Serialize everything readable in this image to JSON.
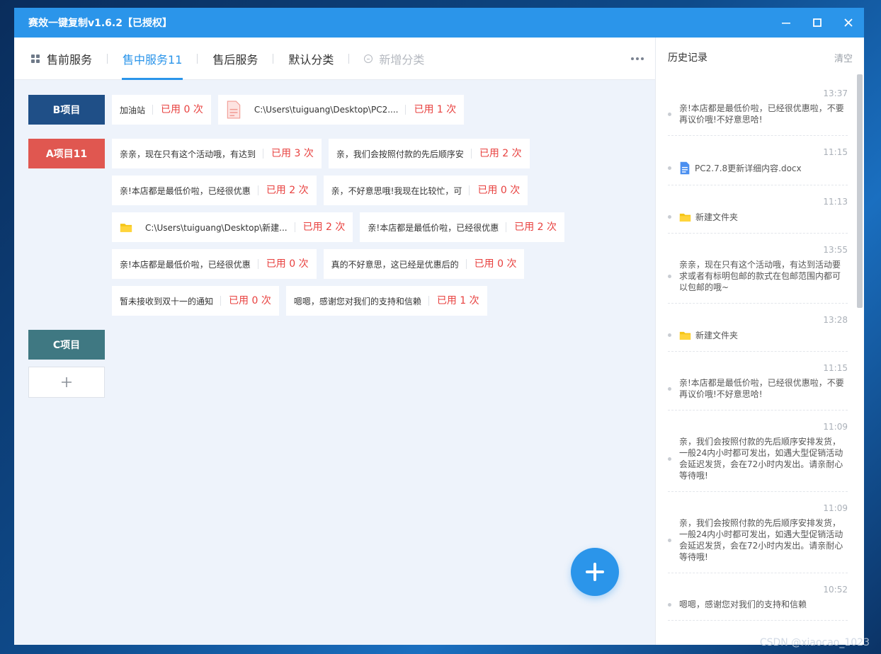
{
  "window": {
    "title": "赛效一键复制v1.6.2【已授权】"
  },
  "tabs": [
    {
      "label": "售前服务",
      "active": false
    },
    {
      "label": "售中服务11",
      "active": true
    },
    {
      "label": "售后服务",
      "active": false
    },
    {
      "label": "默认分类",
      "active": false
    },
    {
      "label": "新增分类",
      "active": false
    }
  ],
  "groups": [
    {
      "label": "B项目",
      "color": "#1f4f87",
      "items": [
        {
          "type": "text",
          "text": "加油站",
          "used": "已用 0 次"
        },
        {
          "type": "doc",
          "text": "C:\\Users\\tuiguang\\Desktop\\PC2....",
          "used": "已用 1 次"
        }
      ]
    },
    {
      "label": "A项目11",
      "color": "#e05750",
      "items": [
        {
          "type": "text",
          "text": "亲亲，现在只有这个活动哦，有达到",
          "used": "已用 3 次"
        },
        {
          "type": "text",
          "text": "亲，我们会按照付款的先后顺序安",
          "used": "已用 2 次"
        },
        {
          "type": "text",
          "text": "亲!本店都是最低价啦，已经很优惠",
          "used": "已用 2 次"
        },
        {
          "type": "text",
          "text": "亲，不好意思哦!我现在比较忙，可",
          "used": "已用 0 次"
        },
        {
          "type": "folder",
          "text": "C:\\Users\\tuiguang\\Desktop\\新建...",
          "used": "已用 2 次"
        },
        {
          "type": "text",
          "text": "亲!本店都是最低价啦，已经很优惠",
          "used": "已用 2 次"
        },
        {
          "type": "text",
          "text": "亲!本店都是最低价啦，已经很优惠",
          "used": "已用 0 次"
        },
        {
          "type": "text",
          "text": "真的不好意思，这已经是优惠后的",
          "used": "已用 0 次"
        },
        {
          "type": "text",
          "text": "暂未接收到双十一的通知",
          "used": "已用 0 次"
        },
        {
          "type": "text",
          "text": "嗯嗯，感谢您对我们的支持和信赖",
          "used": "已用 1 次"
        }
      ]
    },
    {
      "label": "C项目",
      "color": "#3f7882",
      "items": []
    }
  ],
  "history": {
    "title": "历史记录",
    "clear_label": "清空",
    "items": [
      {
        "time": "13:37",
        "type": "text",
        "text": "亲!本店都是最低价啦，已经很优惠啦，不要再议价哦!不好意思哈!"
      },
      {
        "time": "11:15",
        "type": "doc",
        "text": "PC2.7.8更新详细内容.docx"
      },
      {
        "time": "11:13",
        "type": "folder",
        "text": "新建文件夹"
      },
      {
        "time": "13:55",
        "type": "text",
        "text": "亲亲，现在只有这个活动哦，有达到活动要求或者有标明包邮的款式在包邮范围内都可以包邮的哦~"
      },
      {
        "time": "13:28",
        "type": "folder",
        "text": "新建文件夹"
      },
      {
        "time": "11:15",
        "type": "text",
        "text": "亲!本店都是最低价啦，已经很优惠啦，不要再议价哦!不好意思哈!"
      },
      {
        "time": "11:09",
        "type": "text",
        "text": "亲，我们会按照付款的先后顺序安排发货，一般24内小时都可发出，如遇大型促销活动会延迟发货，会在72小时内发出。请亲耐心等待哦!"
      },
      {
        "time": "11:09",
        "type": "text",
        "text": "亲，我们会按照付款的先后顺序安排发货，一般24内小时都可发出，如遇大型促销活动会延迟发货，会在72小时内发出。请亲耐心等待哦!"
      },
      {
        "time": "10:52",
        "type": "text",
        "text": "嗯嗯，感谢您对我们的支持和信赖"
      }
    ]
  },
  "watermark": "CSDN @xiaocao_1023"
}
